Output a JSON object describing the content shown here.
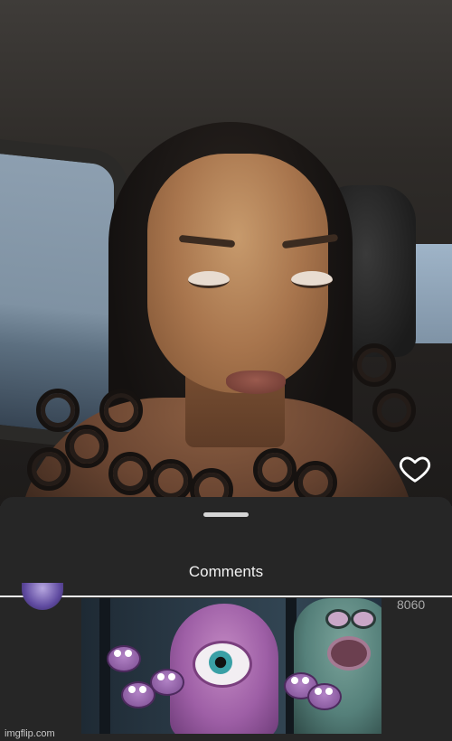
{
  "photo_overlay": {
    "like_icon": "heart-outline-icon"
  },
  "comments_sheet": {
    "title": "Comments",
    "handle": "drag-handle"
  },
  "comment": {
    "like_count": "8060",
    "image_watermark": "imgflip.com"
  },
  "colors": {
    "background": "#262626",
    "divider": "#f4f4f4",
    "text_primary": "#f2f2f2",
    "text_secondary": "#a9a9a9"
  }
}
